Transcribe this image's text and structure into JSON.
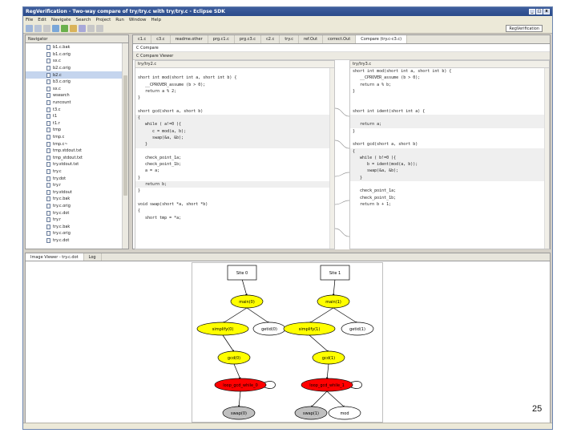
{
  "window": {
    "title": "RegVerification - Two-way compare of try/try.c with try/try.c - Eclipse SDK",
    "controls": [
      "_",
      "□",
      "x"
    ]
  },
  "menu": [
    "File",
    "Edit",
    "Navigate",
    "Search",
    "Project",
    "Run",
    "Window",
    "Help"
  ],
  "perspective": "RegVerification",
  "navigator": {
    "tab_label": "Navigator",
    "items": [
      "b1.c.bak",
      "b1.c.orig",
      "sx.c",
      "b2.c.orig",
      "b2.c",
      "b3.c.orig",
      "sx.c",
      "wsearch",
      "runcount",
      "t3.c",
      "t1",
      "t1.r",
      "tmp",
      "tmp.c",
      "tmp.c~",
      "tmp.stdout.txt",
      "tmp_stdout.txt",
      "try.stdout.txt",
      "try.c",
      "try.dot",
      "try.r",
      "try.stdout",
      "try.c.bak",
      "try.c.orig",
      "try.c.dot",
      "try.r",
      "try.c.bak",
      "try.c.orig",
      "try.c.dot"
    ],
    "selected_index": 4
  },
  "editor_tabs": [
    {
      "label": "c1.c",
      "active": false
    },
    {
      "label": "c3.c",
      "active": false
    },
    {
      "label": "readme.other",
      "active": false
    },
    {
      "label": "prg.c1.c",
      "active": false
    },
    {
      "label": "prg.c3.c",
      "active": false
    },
    {
      "label": "c2.c",
      "active": false
    },
    {
      "label": "try.c",
      "active": false
    },
    {
      "label": "ref.Out",
      "active": false
    },
    {
      "label": "correct.Out",
      "active": false
    },
    {
      "label": "Compare (try.c-c3.c)",
      "active": true
    }
  ],
  "compare": {
    "crumb": "C Compare",
    "viewer_title": "C Compare Viewer",
    "left_header": "try/try2.c",
    "right_header": "try/try3.c",
    "left_lines": [
      {
        "t": "",
        "hl": false
      },
      {
        "t": "short int mod(short int a, short int b) {",
        "hl": false
      },
      {
        "t": "   __CPROVER_assume (b > 0);",
        "hl": false
      },
      {
        "t": "   return a % 2;",
        "hl": false
      },
      {
        "t": "}",
        "hl": false
      },
      {
        "t": "",
        "hl": false
      },
      {
        "t": "short gcd(short a, short b)",
        "hl": false
      },
      {
        "t": "{",
        "hl": true
      },
      {
        "t": "   while ( a!=0 ){",
        "hl": true
      },
      {
        "t": "      c = mod(a, b);",
        "hl": true
      },
      {
        "t": "      swap(&a, &b);",
        "hl": true
      },
      {
        "t": "   }",
        "hl": true
      },
      {
        "t": "",
        "hl": false
      },
      {
        "t": "   check_point_1a;",
        "hl": false
      },
      {
        "t": "   check_point_1b;",
        "hl": false
      },
      {
        "t": "   a = a;",
        "hl": false
      },
      {
        "t": "}",
        "hl": false
      },
      {
        "t": "   return b;",
        "hl": true
      },
      {
        "t": "}",
        "hl": false
      },
      {
        "t": "",
        "hl": false
      },
      {
        "t": "void swap(short *a, short *b)",
        "hl": false
      },
      {
        "t": "{",
        "hl": false
      },
      {
        "t": "   short tmp = *a;",
        "hl": false
      }
    ],
    "right_lines": [
      {
        "t": "short int mod(short int a, short int b) {",
        "hl": false
      },
      {
        "t": "   __CPROVER_assume (b > 0);",
        "hl": false
      },
      {
        "t": "   return a % b;",
        "hl": false
      },
      {
        "t": "}",
        "hl": false
      },
      {
        "t": "",
        "hl": false
      },
      {
        "t": "",
        "hl": false
      },
      {
        "t": "short int ident(short int a) {",
        "hl": false
      },
      {
        "t": "",
        "hl": true
      },
      {
        "t": "   return a;",
        "hl": true
      },
      {
        "t": "}",
        "hl": false
      },
      {
        "t": "",
        "hl": false
      },
      {
        "t": "short gcd(short a, short b)",
        "hl": false
      },
      {
        "t": "{",
        "hl": true
      },
      {
        "t": "   while ( b!=0 ){",
        "hl": true
      },
      {
        "t": "      b = ident(mod(a, b));",
        "hl": true
      },
      {
        "t": "      swap(&a, &b);",
        "hl": true
      },
      {
        "t": "   }",
        "hl": true
      },
      {
        "t": "",
        "hl": false
      },
      {
        "t": "   check_point_1a;",
        "hl": false
      },
      {
        "t": "   check_point_1b;",
        "hl": false
      },
      {
        "t": "   return b + 1;",
        "hl": false
      }
    ]
  },
  "bottom_tabs": [
    {
      "label": "Image Viewer - try.c.dot",
      "active": true
    },
    {
      "label": "Log",
      "active": false
    }
  ],
  "graph": {
    "nodes": [
      {
        "label": "Site 0",
        "shape": "box",
        "color": "#ffffff"
      },
      {
        "label": "main(0)",
        "shape": "ellipse",
        "color": "#ffff00"
      },
      {
        "label": "simplify(0)",
        "shape": "ellipse",
        "color": "#ffff00"
      },
      {
        "label": "getid(0)",
        "shape": "ellipse",
        "color": "#ffffff"
      },
      {
        "label": "gcd(0)",
        "shape": "ellipse",
        "color": "#ffff00"
      },
      {
        "label": "loop_gcd_while_0",
        "shape": "ellipse",
        "color": "#ff0000"
      },
      {
        "label": "swap(0)",
        "shape": "ellipse",
        "color": "#c0c0c0"
      },
      {
        "label": "Site 1",
        "shape": "box",
        "color": "#ffffff"
      },
      {
        "label": "main(1)",
        "shape": "ellipse",
        "color": "#ffff00"
      },
      {
        "label": "simplify(1)",
        "shape": "ellipse",
        "color": "#ffff00"
      },
      {
        "label": "getid(1)",
        "shape": "ellipse",
        "color": "#ffffff"
      },
      {
        "label": "gcd(1)",
        "shape": "ellipse",
        "color": "#ffff00"
      },
      {
        "label": "loop_gcd_while_1",
        "shape": "ellipse",
        "color": "#ff0000"
      },
      {
        "label": "swap(1)",
        "shape": "ellipse",
        "color": "#c0c0c0"
      },
      {
        "label": "mod",
        "shape": "ellipse",
        "color": "#ffffff"
      }
    ]
  },
  "slide_number": "25"
}
